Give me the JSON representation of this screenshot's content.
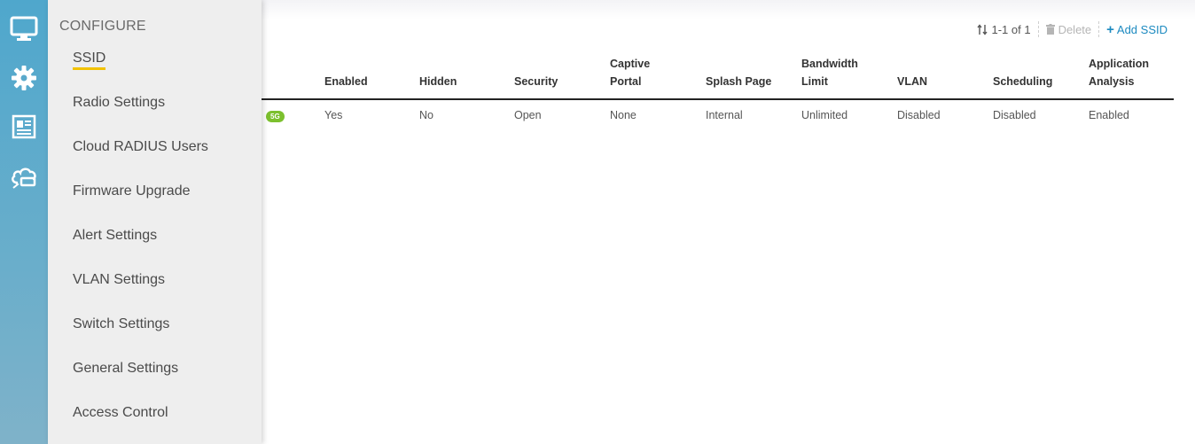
{
  "rail": {
    "icons": [
      "monitor-icon",
      "gear-icon",
      "report-icon",
      "cloud-device-icon"
    ],
    "color": "#5aa9cb"
  },
  "panel": {
    "title": "CONFIGURE",
    "items": [
      {
        "label": "SSID",
        "active": true
      },
      {
        "label": "Radio Settings"
      },
      {
        "label": "Cloud RADIUS Users"
      },
      {
        "label": "Firmware Upgrade"
      },
      {
        "label": "Alert Settings"
      },
      {
        "label": "VLAN Settings"
      },
      {
        "label": "Switch Settings"
      },
      {
        "label": "General Settings"
      },
      {
        "label": "Access Control"
      }
    ],
    "active_accent": "#f2c200"
  },
  "toolbar": {
    "count": "1-1 of 1",
    "delete_label": "Delete",
    "add_label": "Add SSID",
    "add_color": "#1c8ac0"
  },
  "table": {
    "columns": [
      {
        "line1": "",
        "line2": "Enabled"
      },
      {
        "line1": "",
        "line2": "Hidden"
      },
      {
        "line1": "",
        "line2": "Security"
      },
      {
        "line1": "Captive",
        "line2": "Portal"
      },
      {
        "line1": "",
        "line2": "Splash Page"
      },
      {
        "line1": "Bandwidth",
        "line2": "Limit"
      },
      {
        "line1": "",
        "line2": "VLAN"
      },
      {
        "line1": "",
        "line2": "Scheduling"
      },
      {
        "line1": "Application",
        "line2": "Analysis"
      }
    ],
    "rows": [
      {
        "band_badge": "5G",
        "cells": [
          "Yes",
          "No",
          "Open",
          "None",
          "Internal",
          "Unlimited",
          "Disabled",
          "Disabled",
          "Enabled"
        ]
      }
    ]
  }
}
